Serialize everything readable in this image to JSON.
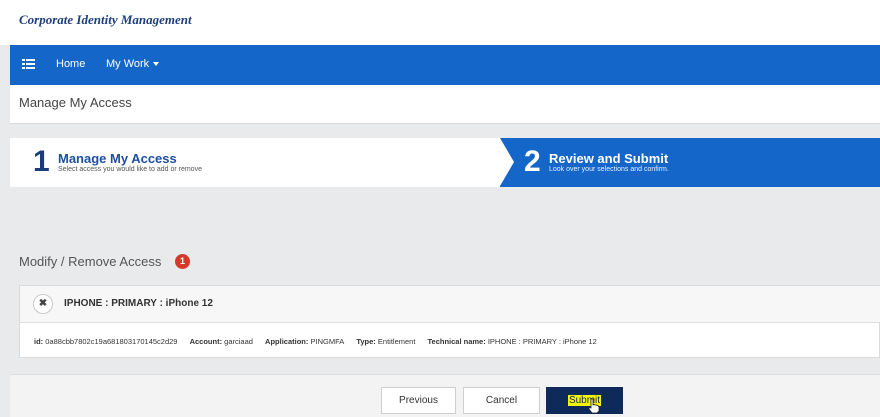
{
  "brand": {
    "title": "Corporate Identity Management"
  },
  "nav": {
    "home": "Home",
    "my_work": "My Work"
  },
  "page": {
    "title": "Manage My Access"
  },
  "wizard": {
    "step1": {
      "number": "1",
      "title": "Manage My Access",
      "description": "Select access you would like to add or remove"
    },
    "step2": {
      "number": "2",
      "title": "Review and Submit",
      "description": "Look over your selections and confirm."
    }
  },
  "section": {
    "title": "Modify / Remove Access",
    "count": "1"
  },
  "item": {
    "remove_symbol": "✖",
    "title": "IPHONE : PRIMARY : iPhone 12",
    "details": [
      {
        "key": "id:",
        "value": "0a88cbb7802c19a681803170145c2d29"
      },
      {
        "key": "Account:",
        "value": "garciaad"
      },
      {
        "key": "Application:",
        "value": "PINGMFA"
      },
      {
        "key": "Type:",
        "value": "Entitlement"
      },
      {
        "key": "Technical name:",
        "value": "IPHONE : PRIMARY : iPhone 12"
      }
    ]
  },
  "buttons": {
    "previous": "Previous",
    "cancel": "Cancel",
    "submit": "Submit"
  },
  "colors": {
    "primary": "#1566c9",
    "dark": "#0e2a5a",
    "badge": "#d9372a"
  }
}
